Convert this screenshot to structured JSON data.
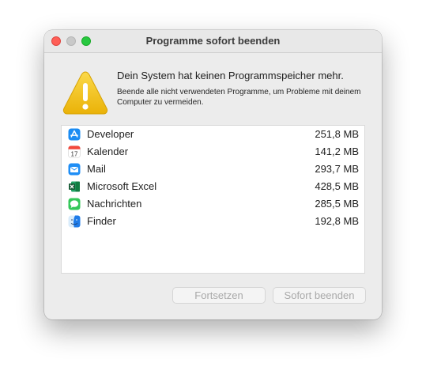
{
  "window": {
    "title": "Programme sofort beenden"
  },
  "message": {
    "headline": "Dein System hat keinen Programmspeicher mehr.",
    "detail": "Beende alle nicht verwendeten Programme, um Probleme mit deinem Computer zu vermeiden."
  },
  "apps": [
    {
      "name": "Developer",
      "memory": "251,8 MB",
      "icon": "app-store-icon"
    },
    {
      "name": "Kalender",
      "memory": "141,2 MB",
      "icon": "calendar-icon"
    },
    {
      "name": "Mail",
      "memory": "293,7 MB",
      "icon": "mail-icon"
    },
    {
      "name": "Microsoft Excel",
      "memory": "428,5 MB",
      "icon": "excel-icon"
    },
    {
      "name": "Nachrichten",
      "memory": "285,5 MB",
      "icon": "messages-icon"
    },
    {
      "name": "Finder",
      "memory": "192,8 MB",
      "icon": "finder-icon"
    }
  ],
  "calendar_icon": {
    "day": "17"
  },
  "buttons": {
    "continue_label": "Fortsetzen",
    "force_quit_label": "Sofort beenden"
  },
  "colors": {
    "close": "#ff5f57",
    "minimize": "#c9c9c9",
    "maximize": "#28c840",
    "warning": "#f5c518"
  }
}
